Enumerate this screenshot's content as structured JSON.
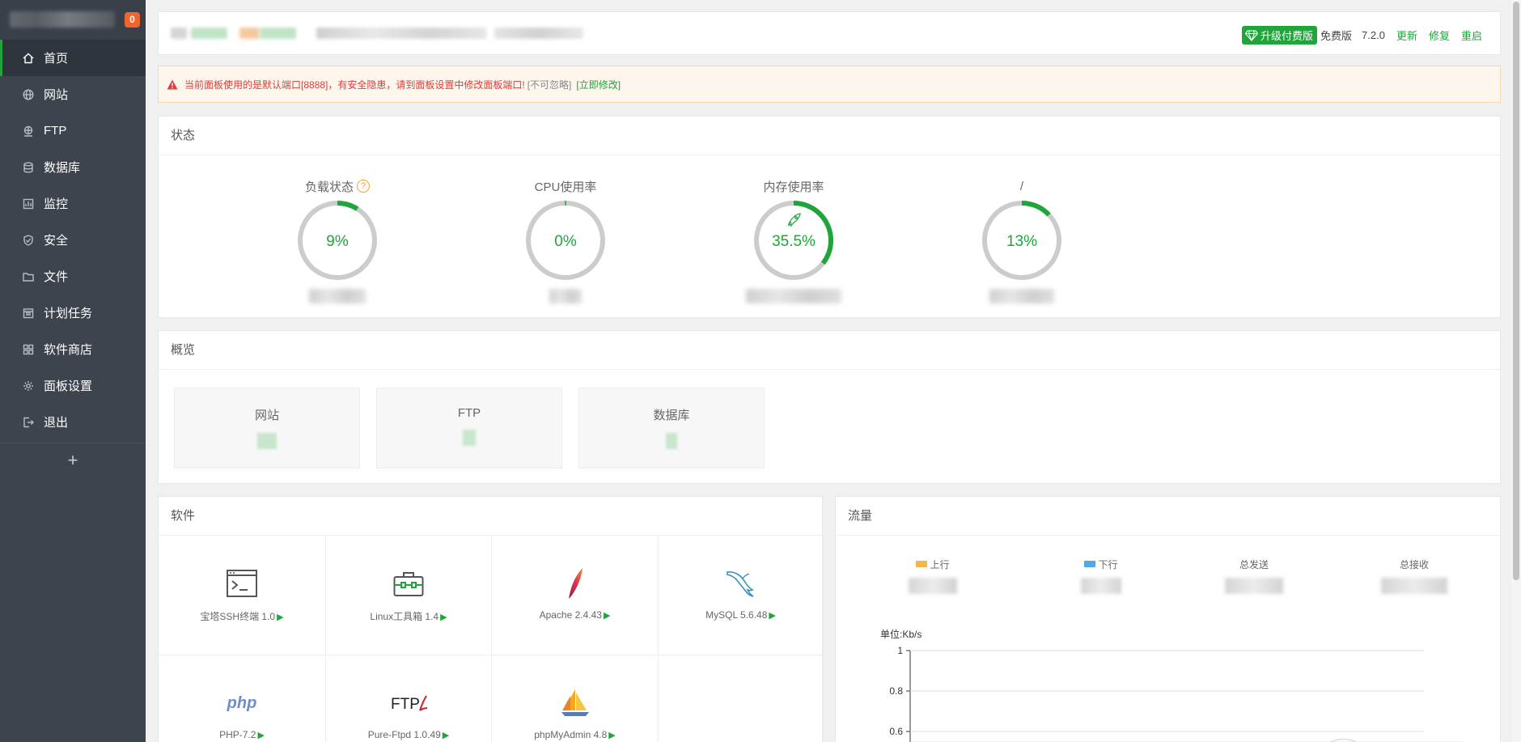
{
  "sidebar": {
    "badge": "0",
    "items": [
      {
        "label": "首页",
        "icon": "home-icon"
      },
      {
        "label": "网站",
        "icon": "globe-icon"
      },
      {
        "label": "FTP",
        "icon": "ftp-icon"
      },
      {
        "label": "数据库",
        "icon": "database-icon"
      },
      {
        "label": "监控",
        "icon": "monitor-icon"
      },
      {
        "label": "安全",
        "icon": "shield-icon"
      },
      {
        "label": "文件",
        "icon": "folder-icon"
      },
      {
        "label": "计划任务",
        "icon": "calendar-icon"
      },
      {
        "label": "软件商店",
        "icon": "grid-icon"
      },
      {
        "label": "面板设置",
        "icon": "gear-icon"
      },
      {
        "label": "退出",
        "icon": "logout-icon"
      }
    ],
    "add_label": "+"
  },
  "topbar": {
    "upgrade_label": "升级付费版",
    "edition": "免费版",
    "version": "7.2.0",
    "update": "更新",
    "repair": "修复",
    "restart": "重启"
  },
  "alert": {
    "text": "当前面板使用的是默认端口[8888]，有安全隐患，请到面板设置中修改面板端口!",
    "ignore": "[不可忽略]",
    "fix": "[立即修改]"
  },
  "status": {
    "title": "状态",
    "gauges": [
      {
        "label": "负载状态",
        "value": "9%",
        "percent": 9,
        "help": "?"
      },
      {
        "label": "CPU使用率",
        "value": "0%",
        "percent": 0
      },
      {
        "label": "内存使用率",
        "value": "35.5%",
        "percent": 35.5
      },
      {
        "label": "/",
        "value": "13%",
        "percent": 13
      }
    ]
  },
  "overview": {
    "title": "概览",
    "boxes": [
      {
        "label": "网站"
      },
      {
        "label": "FTP"
      },
      {
        "label": "数据库"
      }
    ]
  },
  "software": {
    "title": "软件",
    "items": [
      {
        "name": "宝塔SSH终端 1.0",
        "icon": "terminal-icon"
      },
      {
        "name": "Linux工具箱 1.4",
        "icon": "toolbox-icon"
      },
      {
        "name": "Apache 2.4.43",
        "icon": "apache-feather-icon"
      },
      {
        "name": "MySQL 5.6.48",
        "icon": "mysql-dolphin-icon"
      },
      {
        "name": "PHP-7.2",
        "icon": "php-logo-icon"
      },
      {
        "name": "Pure-Ftpd 1.0.49",
        "icon": "ftp-logo-icon"
      },
      {
        "name": "phpMyAdmin 4.8",
        "icon": "phpmyadmin-sailboat-icon"
      }
    ],
    "play": "▶"
  },
  "traffic": {
    "title": "流量",
    "up_label": "上行",
    "down_label": "下行",
    "total_sent": "总发送",
    "total_recv": "总接收",
    "up_color": "#f0b84b",
    "down_color": "#52a9e6",
    "unit": "单位:Kb/s"
  },
  "chart_data": {
    "type": "line",
    "ylabel": "单位:Kb/s",
    "ylim": [
      0.5,
      1
    ],
    "yticks": [
      "1",
      "0.8",
      "0.6"
    ],
    "series": [
      {
        "name": "上行",
        "values": []
      },
      {
        "name": "下行",
        "values": []
      }
    ],
    "grid": true
  }
}
